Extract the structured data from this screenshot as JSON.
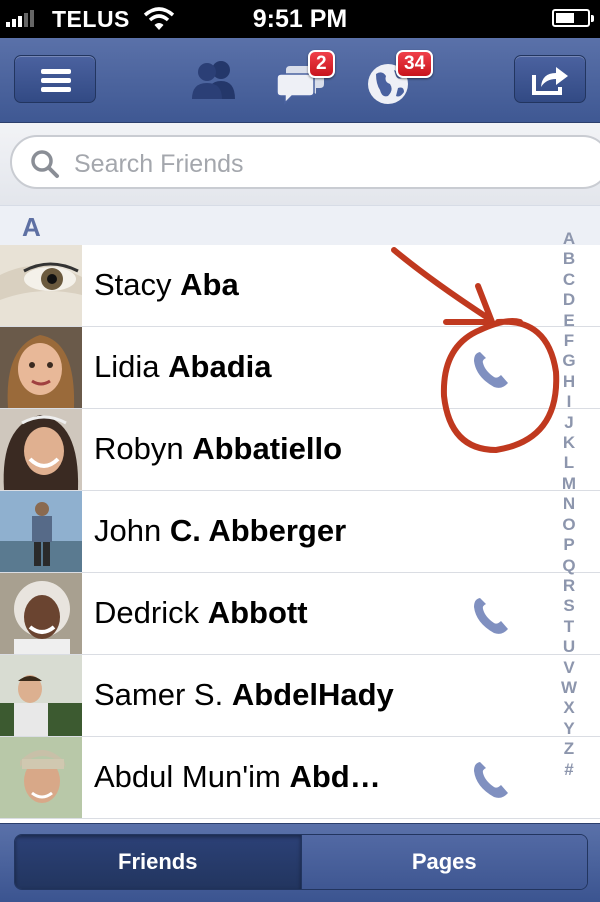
{
  "status_bar": {
    "carrier": "TELUS",
    "time": "9:51 PM"
  },
  "nav": {
    "icons": {
      "menu": "menu-icon",
      "friends": "friend-requests-icon",
      "messages": "messages-icon",
      "notifications": "notifications-globe-icon",
      "share": "share-icon"
    },
    "messages_badge": "2",
    "notifications_badge": "34"
  },
  "search": {
    "placeholder": "Search Friends"
  },
  "section_header": "A",
  "friends": [
    {
      "first": "Stacy",
      "last": "Aba",
      "has_phone": false
    },
    {
      "first": "Lidia",
      "last": "Abadia",
      "has_phone": true
    },
    {
      "first": "Robyn",
      "last": "Abbatiello",
      "has_phone": false
    },
    {
      "first": "John",
      "last": "C. Abberger",
      "has_phone": false
    },
    {
      "first": "Dedrick",
      "last": "Abbott",
      "has_phone": true
    },
    {
      "first": "Samer S.",
      "last": "AbdelHady",
      "has_phone": false
    },
    {
      "first": "Abdul Mun'im",
      "last": "Abd…",
      "has_phone": true
    }
  ],
  "index_letters": [
    "A",
    "B",
    "C",
    "D",
    "E",
    "F",
    "G",
    "H",
    "I",
    "J",
    "K",
    "L",
    "M",
    "N",
    "O",
    "P",
    "Q",
    "R",
    "S",
    "T",
    "U",
    "V",
    "W",
    "X",
    "Y",
    "Z",
    "#"
  ],
  "tabs": [
    {
      "label": "Friends",
      "active": true
    },
    {
      "label": "Pages",
      "active": false
    }
  ],
  "colors": {
    "nav_blue": "#4a62a0",
    "annotation_red": "#c0391f",
    "phone_icon": "#8090c0"
  }
}
